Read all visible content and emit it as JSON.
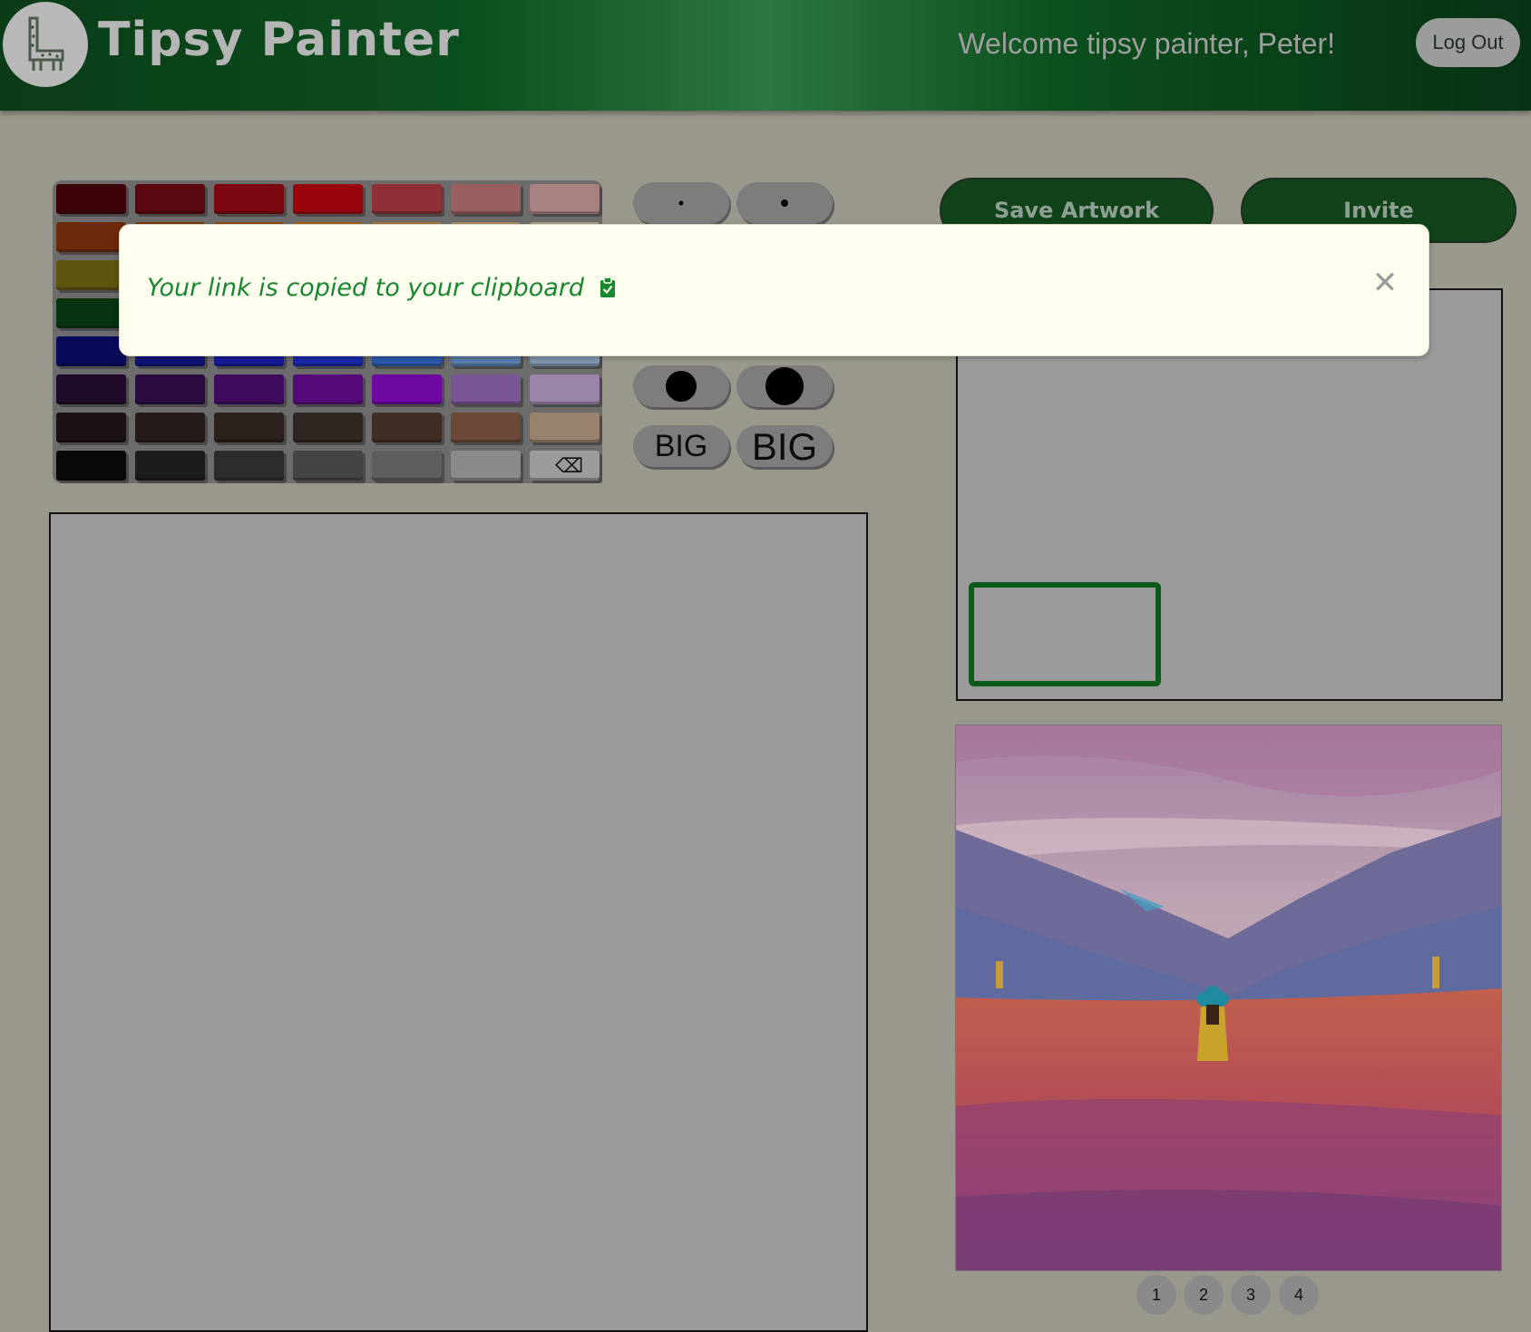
{
  "header": {
    "app_title": "Tipsy Painter",
    "welcome_text": "Welcome tipsy painter, Peter!",
    "logout_label": "Log Out",
    "logo_icon": "llama-icon"
  },
  "palette": {
    "rows": [
      [
        "#3c0309",
        "#5a0710",
        "#7c0711",
        "#9a050d",
        "#8e3036",
        "#99605f",
        "#a88283"
      ],
      [
        "#6b2a08",
        "#7b3808",
        "#8e4a0a",
        "#a05e10",
        "#a67337",
        "#a88a63",
        "#aa9c88"
      ],
      [
        "#5c5410",
        "#6c640d",
        "#7a720f",
        "#8a8213",
        "#928a3c",
        "#9a9468",
        "#a3a08c"
      ],
      [
        "#063310",
        "#0a4416",
        "#0f561c",
        "#156a22",
        "#3a7b44",
        "#5e8e66",
        "#84a28a"
      ],
      [
        "#0a0a5a",
        "#101478",
        "#151c96",
        "#1a28a8",
        "#2f59ad",
        "#5a7eab",
        "#8097ad"
      ],
      [
        "#210b2a",
        "#2a0b3f",
        "#3d0c60",
        "#560a7a",
        "#6f08a2",
        "#7a5697",
        "#9a84a8"
      ],
      [
        "#1a1212",
        "#241b19",
        "#2a201c",
        "#2f2822",
        "#3f2e24",
        "#6b4936",
        "#98816d"
      ],
      [
        "#080808",
        "#1c1c1c",
        "#2c2c2c",
        "#444444",
        "#5e5e5e",
        "#8a8a8a",
        "eraser"
      ]
    ],
    "eraser_icon": "eraser-icon"
  },
  "brushes": {
    "big_labels": [
      "BIG",
      "BIG"
    ]
  },
  "actions": {
    "save_label": "Save Artwork",
    "invite_label": "Invite"
  },
  "reference": {
    "pages": [
      "1",
      "2",
      "3",
      "4"
    ]
  },
  "toast": {
    "message": "Your link is copied to your clipboard",
    "icon": "clipboard-check-icon",
    "close_icon": "close-icon"
  }
}
